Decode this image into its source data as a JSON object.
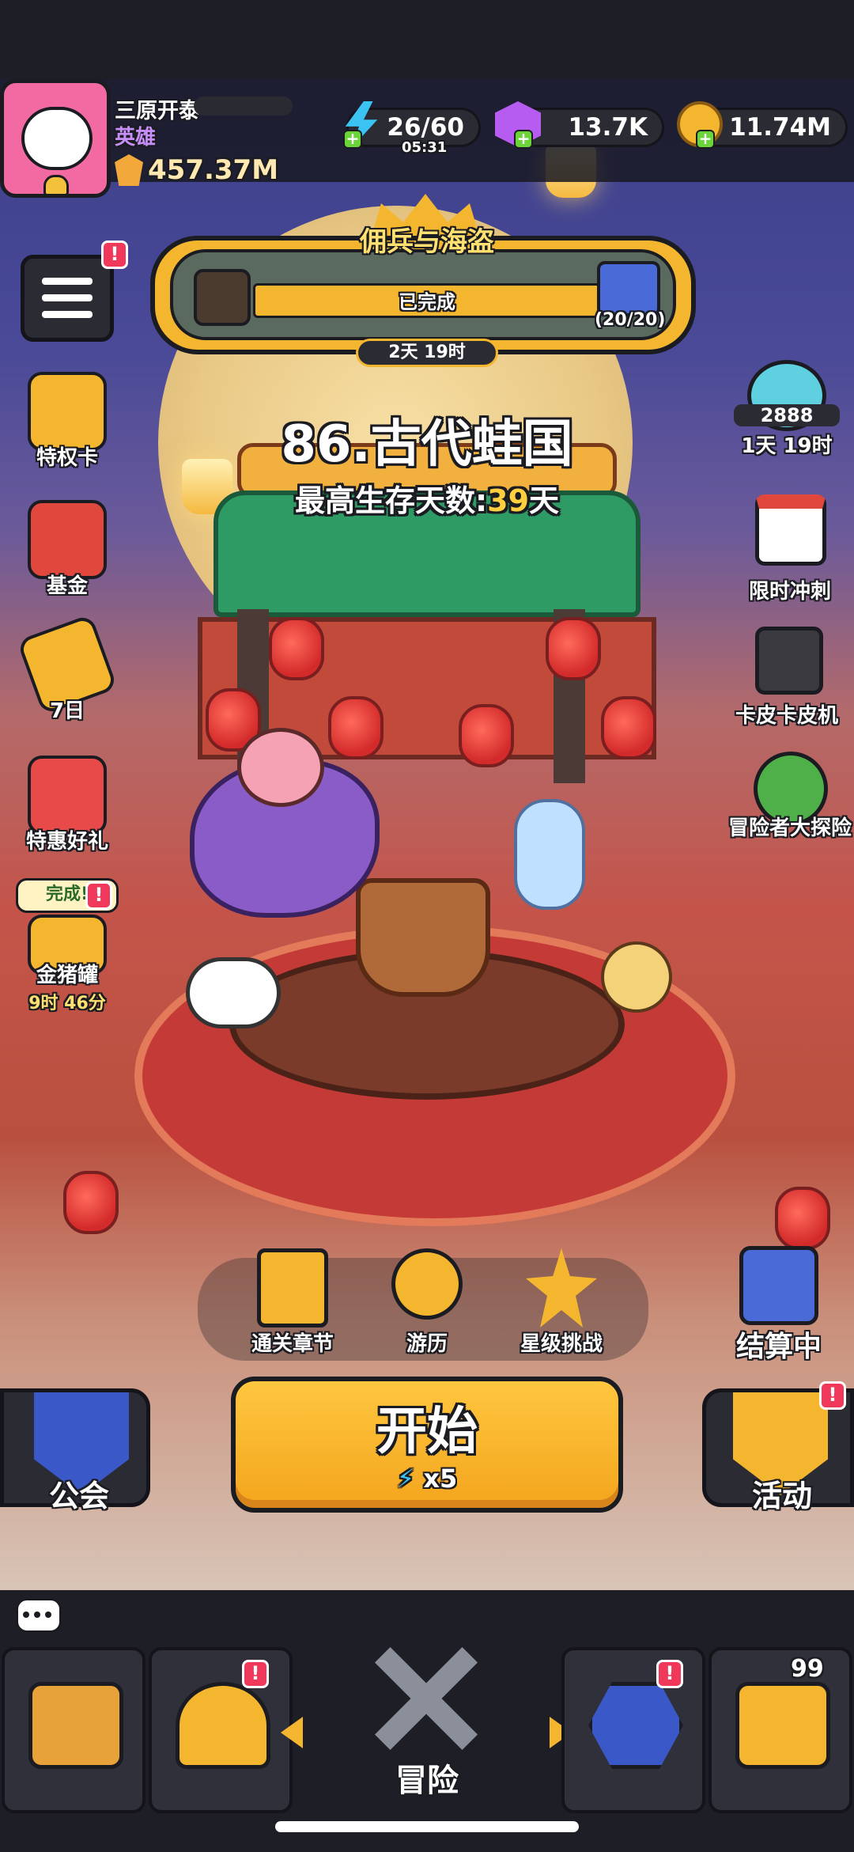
{
  "player": {
    "name": "三原开泰",
    "title": "英雄",
    "power": "457.37M"
  },
  "resources": {
    "energy": "26/60",
    "energy_timer": "05:31",
    "gems": "13.7K",
    "gold": "11.74M"
  },
  "event": {
    "title": "佣兵与海盗",
    "status": "已完成",
    "progress": "(20/20)",
    "timer": "2天 19时"
  },
  "stage": {
    "title": "86.古代蛙国",
    "survival_prefix": "最高生存天数:",
    "survival_days": "39",
    "survival_suffix": "天"
  },
  "left_menu": [
    {
      "label": "特权卡",
      "icon": "privilege-card-icon"
    },
    {
      "label": "基金",
      "icon": "fund-chart-icon"
    },
    {
      "label": "7日",
      "icon": "seven-day-icon"
    },
    {
      "label": "特惠好礼",
      "icon": "gift-box-icon"
    },
    {
      "label": "金猪罐",
      "icon": "piggy-bank-icon",
      "bubble": "完成!",
      "timer": "9时 46分"
    }
  ],
  "right_menu": {
    "ranking": {
      "value": "2888",
      "timer": "1天 19时"
    },
    "items": [
      {
        "label": "限时冲刺",
        "icon": "calendar-icon"
      },
      {
        "label": "卡皮卡皮机",
        "icon": "slot-machine-icon"
      },
      {
        "label": "冒险者大探险",
        "icon": "compass-ring-icon"
      }
    ]
  },
  "actions": [
    {
      "label": "通关章节",
      "icon": "chapter-chest-icon"
    },
    {
      "label": "游历",
      "icon": "travel-compass-icon"
    },
    {
      "label": "星级挑战",
      "icon": "star-challenge-icon"
    }
  ],
  "settling": {
    "label": "结算中"
  },
  "start": {
    "label": "开始",
    "cost": "x5"
  },
  "guild": {
    "label": "公会"
  },
  "activity": {
    "label": "活动"
  },
  "nav": {
    "active_label": "冒险",
    "chest_count": "99"
  },
  "badges": {
    "alert": "!"
  },
  "colors": {
    "accent": "#f5b62f",
    "badge": "#f0395a",
    "title_purple": "#c78ef7",
    "days_yellow": "#ffcf3f"
  }
}
